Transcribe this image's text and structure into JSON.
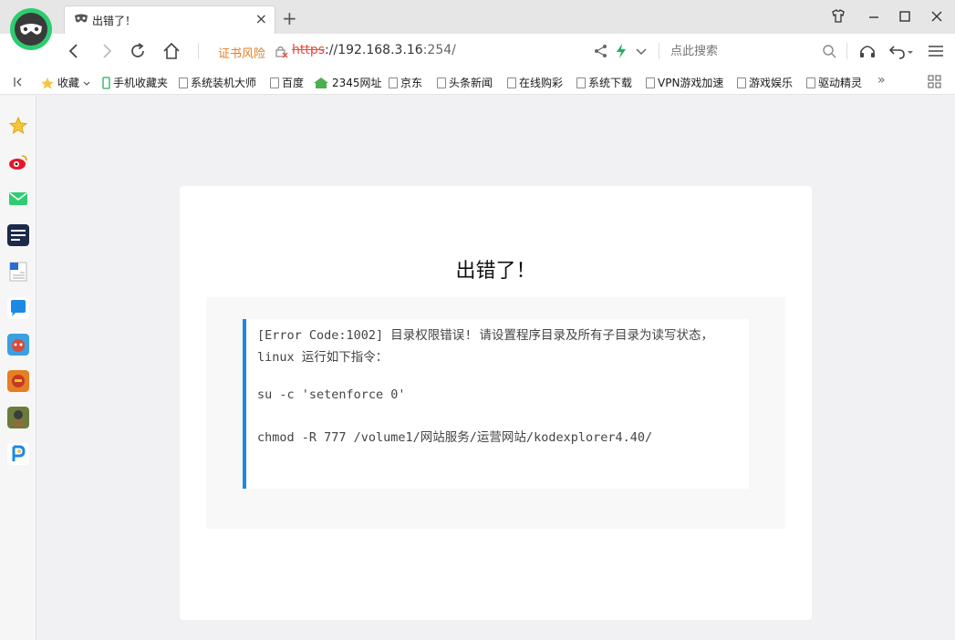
{
  "tab": {
    "title": "出错了！",
    "close": "×"
  },
  "newtab": "+",
  "address": {
    "cert_warning": "证书风险",
    "url_protocol": "https",
    "url_host": "://192.168.3.16",
    "url_port": ":254/",
    "search_placeholder": "点此搜索"
  },
  "bookmarks": {
    "favorites": "收藏",
    "items": [
      "手机收藏夹",
      "系统装机大师",
      "百度",
      "2345网址",
      "京东",
      "头条新闻",
      "在线购彩",
      "系统下载",
      "VPN游戏加速",
      "游戏娱乐",
      "驱动精灵"
    ],
    "more": "»"
  },
  "sidebar_icons": [
    "star-icon",
    "weibo-icon",
    "mail-icon",
    "news-icon",
    "word-icon",
    "chat-icon",
    "game-icon-1",
    "game-icon-2",
    "game-icon-3",
    "pin-icon"
  ],
  "page": {
    "title": "出错了！",
    "lines": [
      "[Error Code:1002] 目录权限错误! 请设置程序目录及所有子目录为读写状态，",
      "linux 运行如下指令：",
      "su -c 'setenforce 0'",
      "chmod -R 777 /volume1/网站服务/运营网站/kodexplorer4.40/"
    ]
  },
  "colors": {
    "accent": "#1e88e5",
    "warning": "#e67e22",
    "danger": "#e74c3c"
  }
}
